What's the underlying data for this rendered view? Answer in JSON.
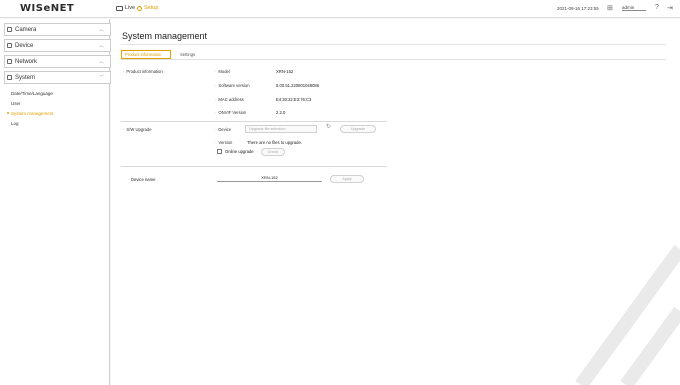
{
  "header": {
    "logo": "WISeNET",
    "nav_live": "Live",
    "nav_setup": "Setup",
    "datetime": "2021-09-16 17:23:55",
    "user": "admin",
    "icons": [
      "monitor-icon",
      "gear-icon",
      "network-icon",
      "help-icon",
      "logout-icon"
    ],
    "accent": "#e0a000"
  },
  "sidebar": {
    "items": [
      {
        "label": "Camera"
      },
      {
        "label": "Device"
      },
      {
        "label": "Network"
      },
      {
        "label": "System"
      }
    ],
    "system_sub": [
      "Date/Time/Language",
      "User",
      "System management",
      "Log"
    ]
  },
  "main": {
    "title": "System management",
    "tabs": [
      {
        "label": "Product information"
      },
      {
        "label": "Settings"
      }
    ],
    "product_info": {
      "section_label": "Product information",
      "rows": [
        {
          "label": "Model",
          "value": "XRN-152"
        },
        {
          "label": "Software version",
          "value": "5.00.51.220801048086"
        },
        {
          "label": "MAC address",
          "value": "E4:30:22:E3:76:C3"
        },
        {
          "label": "ONVIF Version",
          "value": "2.2.0"
        }
      ]
    },
    "sw_upgrade": {
      "section_label": "S/W Upgrade",
      "device_label": "Device",
      "device_select": "Upgrade file selection",
      "upgrade_button": "Upgrade",
      "version_label": "Version",
      "version_value": "There are no files to upgrade.",
      "online_label": "Online upgrade",
      "online_button": "Check"
    },
    "device_name": {
      "label": "Device name",
      "value": "XRN-152",
      "apply_button": "Apply"
    }
  }
}
